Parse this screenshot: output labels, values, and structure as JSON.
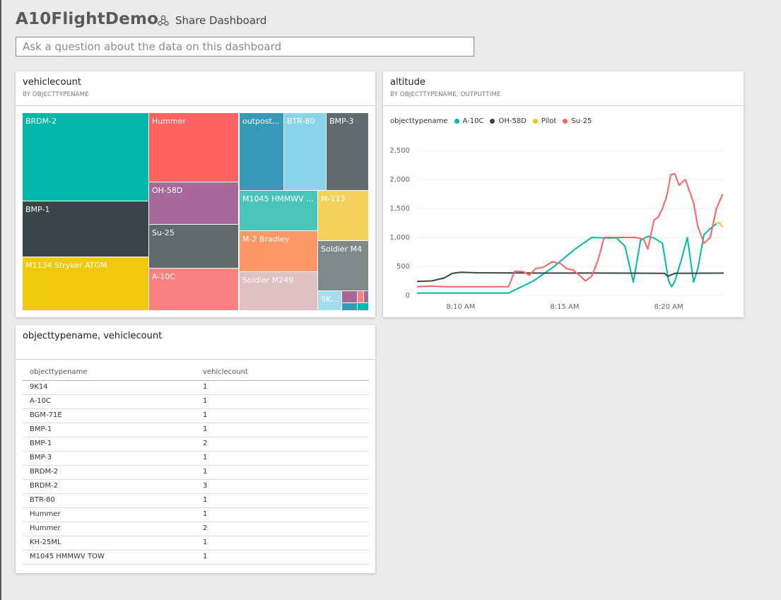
{
  "dashboard": {
    "title": "A10FlightDemo",
    "share_label": "Share Dashboard",
    "qa_placeholder": "Ask a question about the data on this dashboard"
  },
  "treemap_tile": {
    "title": "vehiclecount",
    "subtitle": "BY OBJECTTYPENAME",
    "cells": [
      {
        "label": "BRDM-2",
        "color": "#01b8aa"
      },
      {
        "label": "BMP-1",
        "color": "#374649"
      },
      {
        "label": "M1134 Stryker ATGM",
        "color": "#f2c80f"
      },
      {
        "label": "Hummer",
        "color": "#fd625e"
      },
      {
        "label": "OH-58D",
        "color": "#a66999"
      },
      {
        "label": "Su-25",
        "color": "#5f6b6d"
      },
      {
        "label": "A-10C",
        "color": "#fb8281"
      },
      {
        "label": "outpost...",
        "color": "#3599b8"
      },
      {
        "label": "BTR-80",
        "color": "#8ad4eb"
      },
      {
        "label": "BMP-3",
        "color": "#5f6b6d"
      },
      {
        "label": "M1045 HMMWV ...",
        "color": "#4ac5bb"
      },
      {
        "label": "M-113",
        "color": "#f4d25a"
      },
      {
        "label": "M-2 Bradley",
        "color": "#fe9666"
      },
      {
        "label": "Soldier M4",
        "color": "#7f898a"
      },
      {
        "label": "Soldier M249",
        "color": "#dfbfbf"
      },
      {
        "label": "9K...",
        "color": "#a4ddee"
      },
      {
        "label": "",
        "color": "#a66999"
      },
      {
        "label": "",
        "color": "#fd8481"
      },
      {
        "label": "",
        "color": "#a66999"
      },
      {
        "label": "",
        "color": "#3599b8"
      },
      {
        "label": "",
        "color": "#01b8aa"
      }
    ]
  },
  "altitude_tile": {
    "title": "altitude",
    "subtitle": "BY OBJECTTYPENAME, OUTPUTTIME",
    "legend_title": "objecttypename",
    "chart_data": {
      "type": "line",
      "title": "altitude",
      "legend_title": "objecttypename",
      "legend_position": "top-left",
      "grid": true,
      "y_ticks": [
        "2,500",
        "2,000",
        "1,500",
        "1,000",
        "500",
        "0"
      ],
      "ylim": [
        0,
        2500
      ],
      "x_ticks": [
        "8:10 AM",
        "8:15 AM",
        "8:20 AM"
      ],
      "x_tick_values": [
        10,
        15,
        20
      ],
      "xlim": [
        7.9,
        22.65
      ],
      "series": [
        {
          "name": "A-10C",
          "color": "#01b8aa",
          "x": [
            7.9,
            12.3,
            13.5,
            14.5,
            15.5,
            16.3,
            16.9,
            17.5,
            17.9,
            18.3,
            18.65,
            19.0,
            19.3,
            19.7,
            20.0,
            20.15,
            20.3,
            20.6,
            20.9,
            21.2,
            21.4,
            21.7,
            22.0,
            22.3
          ],
          "y": [
            40,
            40,
            250,
            500,
            800,
            1000,
            990,
            990,
            850,
            230,
            950,
            1020,
            990,
            900,
            250,
            150,
            250,
            600,
            1000,
            230,
            450,
            1050,
            1150,
            1240
          ]
        },
        {
          "name": "OH-58D",
          "color": "#374649",
          "x": [
            7.9,
            8.6,
            9.2,
            9.6,
            10.0,
            10.8,
            14.0,
            17.0,
            19.8,
            19.95,
            20.3,
            22.65
          ],
          "y": [
            240,
            250,
            300,
            380,
            400,
            390,
            385,
            385,
            380,
            330,
            380,
            385
          ]
        },
        {
          "name": "Pilot",
          "color": "#f2c80f",
          "x": [
            22.3,
            22.45,
            22.6
          ],
          "y": [
            1260,
            1250,
            1180
          ]
        },
        {
          "name": "Su-25",
          "color": "#fd625e",
          "x": [
            7.9,
            8.6,
            9.2,
            9.6,
            10.2,
            12.3,
            12.6,
            13.0,
            13.3,
            13.6,
            14.0,
            14.4,
            14.8,
            15.1,
            15.4,
            15.7,
            16.0,
            16.3,
            16.6,
            16.9,
            17.2,
            17.5,
            18.0,
            18.4,
            18.8,
            19.0,
            19.3,
            19.5,
            19.7,
            19.9,
            20.1,
            20.3,
            20.5,
            20.8,
            21.0,
            21.2,
            21.4,
            21.7,
            22.0,
            22.3,
            22.6
          ],
          "y": [
            150,
            160,
            150,
            150,
            150,
            150,
            420,
            410,
            350,
            460,
            490,
            580,
            550,
            460,
            440,
            350,
            250,
            330,
            600,
            1000,
            1000,
            1000,
            1000,
            1000,
            970,
            800,
            1300,
            1350,
            1500,
            1700,
            2080,
            2100,
            1900,
            2000,
            1800,
            1600,
            1200,
            900,
            1000,
            1500,
            1750
          ]
        }
      ]
    }
  },
  "table_tile": {
    "title": "objecttypename, vehiclecount",
    "columns": [
      "objecttypename",
      "vehiclecount"
    ],
    "rows": [
      [
        "9K14",
        "1"
      ],
      [
        "A-10C",
        "1"
      ],
      [
        "BGM-71E",
        "1"
      ],
      [
        "BMP-1",
        "1"
      ],
      [
        "BMP-1",
        "2"
      ],
      [
        "BMP-3",
        "1"
      ],
      [
        "BRDM-2",
        "1"
      ],
      [
        "BRDM-2",
        "3"
      ],
      [
        "BTR-80",
        "1"
      ],
      [
        "Hummer",
        "1"
      ],
      [
        "Hummer",
        "2"
      ],
      [
        "KH-25ML",
        "1"
      ],
      [
        "M1045 HMMWV TOW",
        "1"
      ]
    ]
  }
}
